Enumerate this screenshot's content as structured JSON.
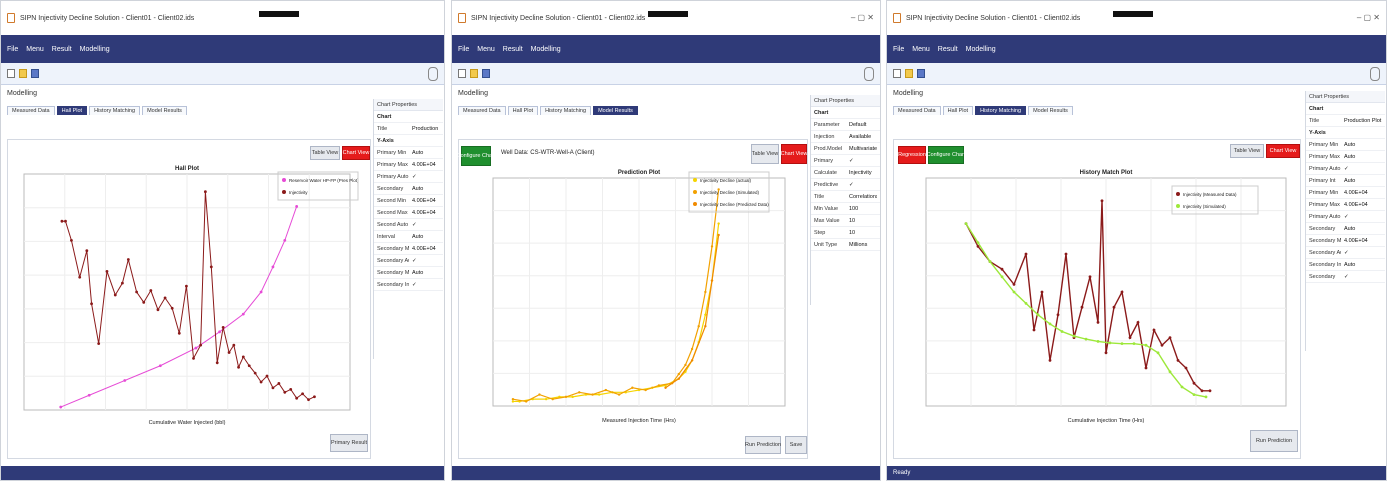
{
  "windows": [
    {
      "title": "SIPN Injectivity Decline Solution - Client01 - Client02.ids",
      "menu": [
        "File",
        "Menu",
        "Result",
        "Modelling"
      ],
      "panel_title": "Modelling",
      "tabs": [
        "Measured Data",
        "Hall Plot",
        "History Matching",
        "Model Results"
      ],
      "active_tab": 1,
      "buttons": {
        "table_view": "Table View",
        "chart_view": "Chart View",
        "primary": "Primary Result"
      },
      "chart_data": {
        "type": "scatter",
        "title": "Hall Plot",
        "xlabel": "Cumulative Water Injected (bbl)",
        "ylabel": "",
        "xlim": [
          -2500,
          25000
        ],
        "ylim": [
          0,
          16000
        ],
        "series": [
          {
            "name": "Reservoir Water HP-FP (Pres Plot)",
            "color": "#e64bd6",
            "x": [
              600,
              3000,
              6000,
              9000,
              12000,
              14000,
              16000,
              17500,
              18500,
              19500,
              20500
            ],
            "y": [
              200,
              1000,
              2000,
              3000,
              4200,
              5300,
              6500,
              8000,
              9700,
              11500,
              13800
            ]
          },
          {
            "name": "Injectivity",
            "color": "#8b1a1a",
            "x": [
              700,
              1000,
              1500,
              2200,
              2800,
              3200,
              3800,
              4500,
              5200,
              5800,
              6300,
              7000,
              7600,
              8200,
              8800,
              9400,
              10000,
              10600,
              11200,
              11800,
              12400,
              12800,
              13300,
              13800,
              14300,
              14800,
              15200,
              15600,
              16000,
              16500,
              17000,
              17500,
              18000,
              18500,
              19000,
              19500,
              20000,
              20500,
              21000,
              21500,
              22000
            ],
            "y": [
              12800,
              12800,
              11500,
              9000,
              10800,
              7200,
              4500,
              9400,
              7800,
              8600,
              10200,
              8000,
              7300,
              8100,
              6800,
              7600,
              6900,
              5200,
              8400,
              3500,
              4400,
              14800,
              9700,
              3200,
              5600,
              3900,
              4400,
              2900,
              3600,
              3000,
              2500,
              1900,
              2300,
              1500,
              1800,
              1200,
              1400,
              800,
              1100,
              700,
              900
            ]
          }
        ]
      },
      "side": {
        "header": "Chart Properties",
        "rows": [
          {
            "k": "Chart",
            "v": "",
            "sec": true
          },
          {
            "k": "Title",
            "v": "Production Plot"
          },
          {
            "k": "Y-Axis",
            "v": "",
            "sec": true
          },
          {
            "k": "Primary Min",
            "v": "Auto"
          },
          {
            "k": "Primary Max",
            "v": "4.00E+04"
          },
          {
            "k": "Primary Auto",
            "v": "✓"
          },
          {
            "k": "Secondary",
            "v": "Auto"
          },
          {
            "k": "Second Min",
            "v": "4.00E+04"
          },
          {
            "k": "Second Max",
            "v": "4.00E+04"
          },
          {
            "k": "Second Auto",
            "v": "✓"
          },
          {
            "k": "Interval",
            "v": "Auto"
          },
          {
            "k": "Secondary Max",
            "v": "4.00E+04"
          },
          {
            "k": "Secondary Auto",
            "v": "✓"
          },
          {
            "k": "Secondary Min",
            "v": "Auto"
          },
          {
            "k": "Secondary Int",
            "v": "✓"
          }
        ]
      },
      "status": ""
    },
    {
      "title": "SIPN Injectivity Decline Solution - Client01 - Client02.ids",
      "menu": [
        "File",
        "Menu",
        "Result",
        "Modelling"
      ],
      "panel_title": "Modelling",
      "tabs": [
        "Measured Data",
        "Hall Plot",
        "History Matching",
        "Model Results"
      ],
      "active_tab": 3,
      "buttons": {
        "configure": "Configure Chart",
        "table_view": "Table View",
        "chart_view": "Chart View",
        "run_prediction": "Run Prediction",
        "save": "Save"
      },
      "label": "Well Data: CS-WTR-Well-A (Client)",
      "chart_data": {
        "type": "scatter",
        "title": "Prediction Plot",
        "xlabel": "Measured Injection Time (Hrs)",
        "ylabel": "",
        "xlim": [
          -1,
          21
        ],
        "ylim": [
          0,
          1
        ],
        "series": [
          {
            "name": "Injectivity Decline (actual)",
            "color": "#f5d400",
            "x": [
              0.5,
              1,
              2,
              3,
              4,
              5,
              6,
              7,
              8,
              9,
              10,
              11,
              12,
              13,
              13.5,
              14,
              14.5,
              15,
              15.5,
              16
            ],
            "y": [
              0.02,
              0.02,
              0.03,
              0.03,
              0.04,
              0.04,
              0.05,
              0.05,
              0.06,
              0.06,
              0.07,
              0.08,
              0.09,
              0.12,
              0.15,
              0.2,
              0.28,
              0.4,
              0.55,
              0.8
            ]
          },
          {
            "name": "Injectivity Decline (Simulated)",
            "color": "#f2a100",
            "x": [
              0.5,
              1.5,
              2.5,
              3.5,
              4.5,
              5.5,
              6.5,
              7.5,
              8.5,
              9.5,
              10.5,
              11.5,
              12.5,
              13,
              13.5,
              14,
              14.5,
              15,
              15.5,
              16
            ],
            "y": [
              0.03,
              0.02,
              0.05,
              0.03,
              0.04,
              0.06,
              0.05,
              0.07,
              0.05,
              0.08,
              0.07,
              0.09,
              0.1,
              0.14,
              0.18,
              0.25,
              0.35,
              0.5,
              0.7,
              0.95
            ]
          },
          {
            "name": "Injectivity Decline (Predicted Data)",
            "color": "#f08a00",
            "x": [
              12,
              13,
              14,
              15,
              15.5,
              16
            ],
            "y": [
              0.08,
              0.12,
              0.2,
              0.35,
              0.55,
              0.75
            ]
          }
        ]
      },
      "side": {
        "header": "Chart Properties",
        "rows": [
          {
            "k": "Chart",
            "v": "",
            "sec": true
          },
          {
            "k": "Parameter",
            "v": "Default"
          },
          {
            "k": "Injection",
            "v": "Available"
          },
          {
            "k": "Prod.Model",
            "v": "Multivariate"
          },
          {
            "k": "Primary",
            "v": "✓"
          },
          {
            "k": "Calculate",
            "v": "Injectivity"
          },
          {
            "k": "Predictive",
            "v": "✓"
          },
          {
            "k": "Title",
            "v": "Correlations"
          },
          {
            "k": "Min Value",
            "v": "100"
          },
          {
            "k": "Max Value",
            "v": "10"
          },
          {
            "k": "Step",
            "v": "10"
          },
          {
            "k": "Unit Type",
            "v": "Millions"
          }
        ]
      },
      "status": ""
    },
    {
      "title": "SIPN Injectivity Decline Solution - Client01 - Client02.ids",
      "menu": [
        "File",
        "Menu",
        "Result",
        "Modelling"
      ],
      "panel_title": "Modelling",
      "tabs": [
        "Measured Data",
        "Hall Plot",
        "History Matching",
        "Model Results"
      ],
      "active_tab": 2,
      "buttons": {
        "regression": "Regression",
        "configure": "Configure Chart",
        "table_view": "Table View",
        "chart_view": "Chart View",
        "run_prediction": "Run Prediction"
      },
      "chart_data": {
        "type": "scatter",
        "title": "History Match Plot",
        "xlabel": "Cumulative Injection Time (Hrs)",
        "ylabel": "",
        "xlim": [
          -1000,
          8000
        ],
        "ylim": [
          0,
          3
        ],
        "series": [
          {
            "name": "Injectivity (Measured Data)",
            "color": "#8b1a1a",
            "x": [
              0,
              300,
              600,
              900,
              1200,
              1500,
              1700,
              1900,
              2100,
              2300,
              2500,
              2700,
              2900,
              3100,
              3300,
              3400,
              3500,
              3700,
              3900,
              4100,
              4300,
              4500,
              4700,
              4900,
              5100,
              5300,
              5500,
              5700,
              5900,
              6100
            ],
            "y": [
              2.4,
              2.1,
              1.9,
              1.8,
              1.6,
              2.0,
              1.0,
              1.5,
              0.6,
              1.2,
              2.0,
              0.9,
              1.3,
              1.7,
              1.1,
              2.7,
              0.7,
              1.3,
              1.5,
              0.9,
              1.1,
              0.5,
              1.0,
              0.8,
              0.9,
              0.6,
              0.5,
              0.3,
              0.2,
              0.2
            ]
          },
          {
            "name": "Injectivity (Simulated)",
            "color": "#9de83a",
            "x": [
              0,
              300,
              600,
              900,
              1200,
              1500,
              1800,
              2100,
              2400,
              2700,
              3000,
              3300,
              3600,
              3900,
              4200,
              4500,
              4800,
              5100,
              5400,
              5700,
              6000
            ],
            "y": [
              2.4,
              2.15,
              1.9,
              1.7,
              1.5,
              1.35,
              1.2,
              1.08,
              0.98,
              0.92,
              0.88,
              0.85,
              0.83,
              0.82,
              0.82,
              0.8,
              0.7,
              0.45,
              0.25,
              0.15,
              0.12
            ]
          }
        ]
      },
      "side": {
        "header": "Chart Properties",
        "rows": [
          {
            "k": "Chart",
            "v": "",
            "sec": true
          },
          {
            "k": "Title",
            "v": "Production Plot"
          },
          {
            "k": "Y-Axis",
            "v": "",
            "sec": true
          },
          {
            "k": "Primary Min",
            "v": "Auto"
          },
          {
            "k": "Primary Max",
            "v": "Auto"
          },
          {
            "k": "Primary Auto",
            "v": "✓"
          },
          {
            "k": "Primary Int",
            "v": "Auto"
          },
          {
            "k": "Primary Min",
            "v": "4.00E+04"
          },
          {
            "k": "Primary Max",
            "v": "4.00E+04"
          },
          {
            "k": "Primary Auto",
            "v": "✓"
          },
          {
            "k": "Secondary",
            "v": "Auto"
          },
          {
            "k": "Secondary Max",
            "v": "4.00E+04"
          },
          {
            "k": "Secondary Auto",
            "v": "✓"
          },
          {
            "k": "Secondary Int",
            "v": "Auto"
          },
          {
            "k": "Secondary",
            "v": "✓"
          }
        ]
      },
      "status": "Ready"
    }
  ]
}
